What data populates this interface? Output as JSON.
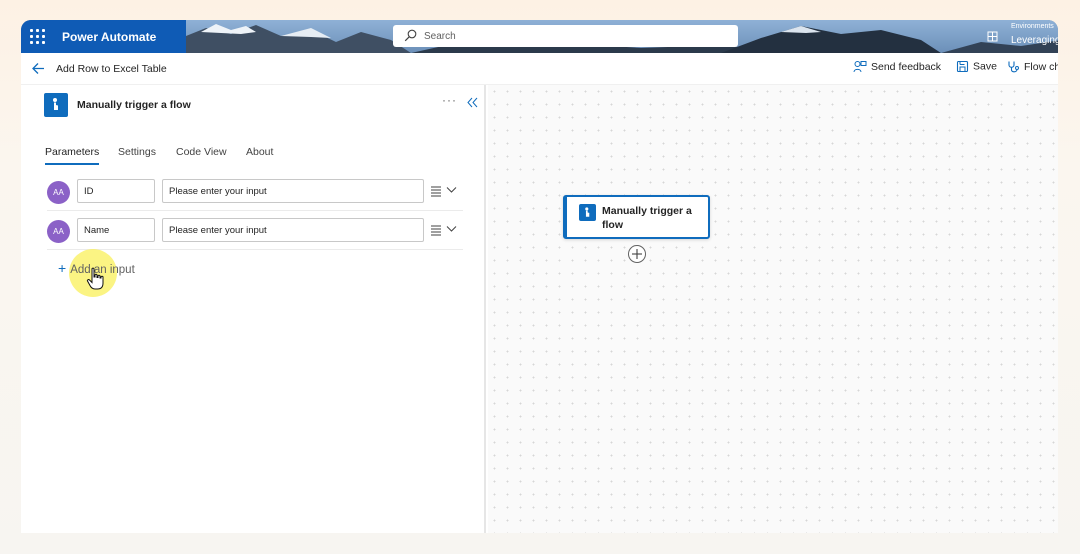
{
  "header": {
    "app_name": "Power Automate",
    "search_placeholder": "Search",
    "environment_label": "Environments",
    "environment_value": "Leveraging"
  },
  "commandbar": {
    "flow_name": "Add Row to Excel Table",
    "send_feedback": "Send feedback",
    "save": "Save",
    "flow_checker": "Flow ch"
  },
  "panel": {
    "title": "Manually trigger a flow",
    "more": "···",
    "tabs": [
      "Parameters",
      "Settings",
      "Code View",
      "About"
    ],
    "active_tab": "Parameters",
    "inputs": [
      {
        "type_icon": "AA",
        "name": "ID",
        "value": "Please enter your input"
      },
      {
        "type_icon": "AA",
        "name": "Name",
        "value": "Please enter your input"
      }
    ],
    "add_input": "Add an input"
  },
  "canvas": {
    "card_label": "Manually trigger a flow"
  },
  "colors": {
    "accent": "#0f6cbd",
    "avatar": "#8b61c7",
    "highlight": "#f5e94e"
  }
}
